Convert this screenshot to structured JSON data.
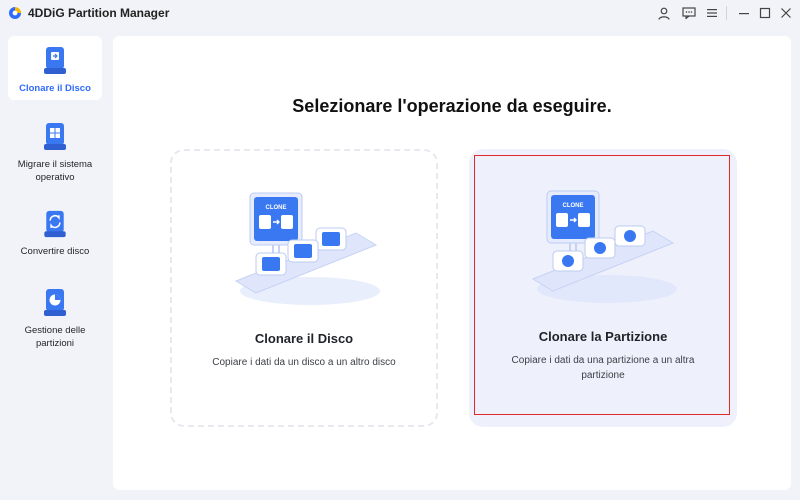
{
  "app": {
    "title": "4DDiG Partition Manager",
    "accent": "#2f6bff"
  },
  "titlebar": {
    "buttons": [
      {
        "icon": "user-icon"
      },
      {
        "icon": "feedback-icon"
      },
      {
        "icon": "menu-icon"
      },
      {
        "icon": "minimize-icon"
      },
      {
        "icon": "maximize-icon"
      },
      {
        "icon": "close-icon"
      }
    ]
  },
  "sidebar": {
    "items": [
      {
        "label": "Clonare il Disco",
        "icon": "clone-disk-icon",
        "active": true
      },
      {
        "label": "Migrare il sistema operativo",
        "icon": "migrate-os-icon",
        "active": false
      },
      {
        "label": "Convertire disco",
        "icon": "convert-disk-icon",
        "active": false
      },
      {
        "label": "Gestione delle partizioni",
        "icon": "partition-management-icon",
        "active": false
      }
    ]
  },
  "main": {
    "heading": "Selezionare l'operazione da eseguire.",
    "cards": [
      {
        "title": "Clonare il Disco",
        "description": "Copiare i dati da un disco a un altro disco",
        "illustration_text": "CLONE",
        "selected": false
      },
      {
        "title": "Clonare la Partizione",
        "description": "Copiare i dati da una partizione a un altra partizione",
        "illustration_text": "CLONE",
        "selected": true
      }
    ]
  }
}
